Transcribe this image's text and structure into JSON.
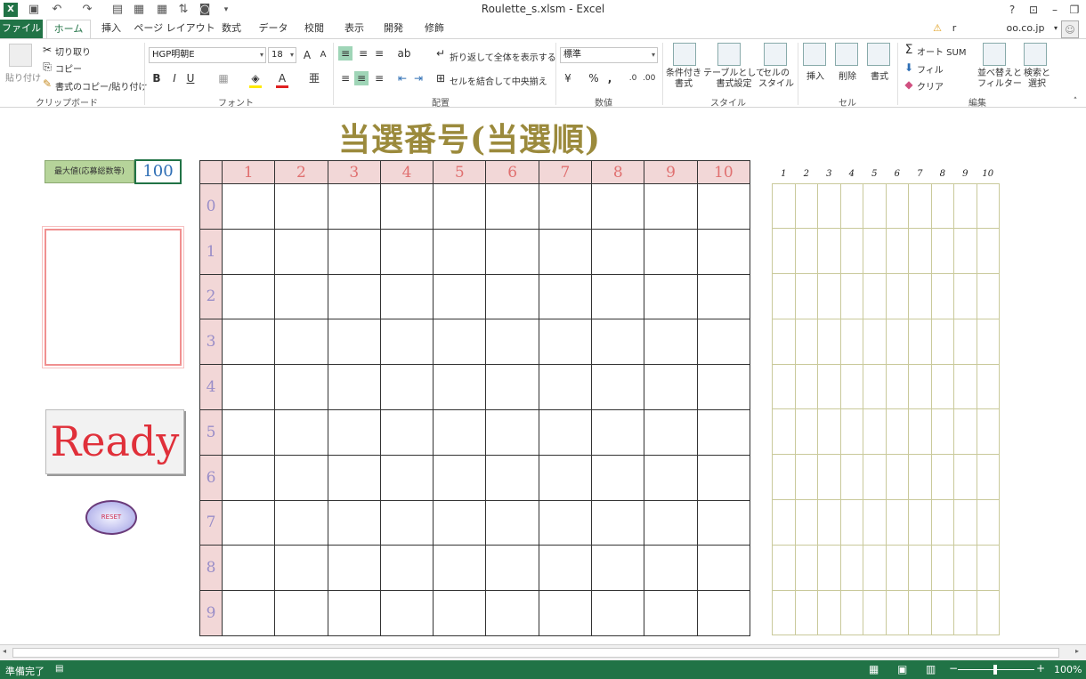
{
  "app": {
    "window_title": "Roulette_s.xlsm - Excel",
    "user": "r",
    "account": "oo.co.jp"
  },
  "tabs": [
    "ファイル",
    "ホーム",
    "挿入",
    "ページ レイアウト",
    "数式",
    "データ",
    "校閲",
    "表示",
    "開発",
    "修飾"
  ],
  "ribbon": {
    "clipboard": {
      "paste": "貼り付け",
      "cut": "切り取り",
      "copy": "コピー",
      "format_painter": "書式のコピー/貼り付け",
      "label": "クリップボード"
    },
    "font": {
      "name": "HGP明朝E",
      "size": "18",
      "bold": "B",
      "italic": "I",
      "underline": "U",
      "label": "フォント"
    },
    "alignment": {
      "wrap_text": "折り返して全体を表示する",
      "merge_center": "セルを結合して中央揃え",
      "label": "配置"
    },
    "number": {
      "format": "標準",
      "percent": "%",
      "comma": ",",
      "label": "数値"
    },
    "styles": {
      "conditional": "条件付き\n書式",
      "as_table": "テーブルとして\n書式設定",
      "cell_styles": "セルの\nスタイル",
      "label": "スタイル"
    },
    "cells": {
      "insert": "挿入",
      "delete": "削除",
      "format": "書式",
      "label": "セル"
    },
    "editing": {
      "autosum": "オート SUM",
      "fill": "フィル",
      "clear": "クリア",
      "sort_filter": "並べ替えと\nフィルター",
      "find_select": "検索と\n選択",
      "label": "編集"
    }
  },
  "sheet": {
    "title": "当選番号(当選順)",
    "max_label": "最大値(応募総数等)",
    "max_value": "100",
    "ready_button": "Ready",
    "reset_button": "RESET",
    "column_headers": [
      "1",
      "2",
      "3",
      "4",
      "5",
      "6",
      "7",
      "8",
      "9",
      "10"
    ],
    "row_headers": [
      "0",
      "1",
      "2",
      "3",
      "4",
      "5",
      "6",
      "7",
      "8",
      "9"
    ],
    "side_headers": [
      "1",
      "2",
      "3",
      "4",
      "5",
      "6",
      "7",
      "8",
      "9",
      "10"
    ]
  },
  "status": {
    "ready": "準備完了",
    "zoom": "100%"
  },
  "colors": {
    "excel_green": "#217346",
    "title_gold": "#9b8a3c",
    "header_pink": "#f2d7d7",
    "col_header_text": "#e07070",
    "row_header_text": "#9a8ec8",
    "ready_red": "#e0303a"
  }
}
